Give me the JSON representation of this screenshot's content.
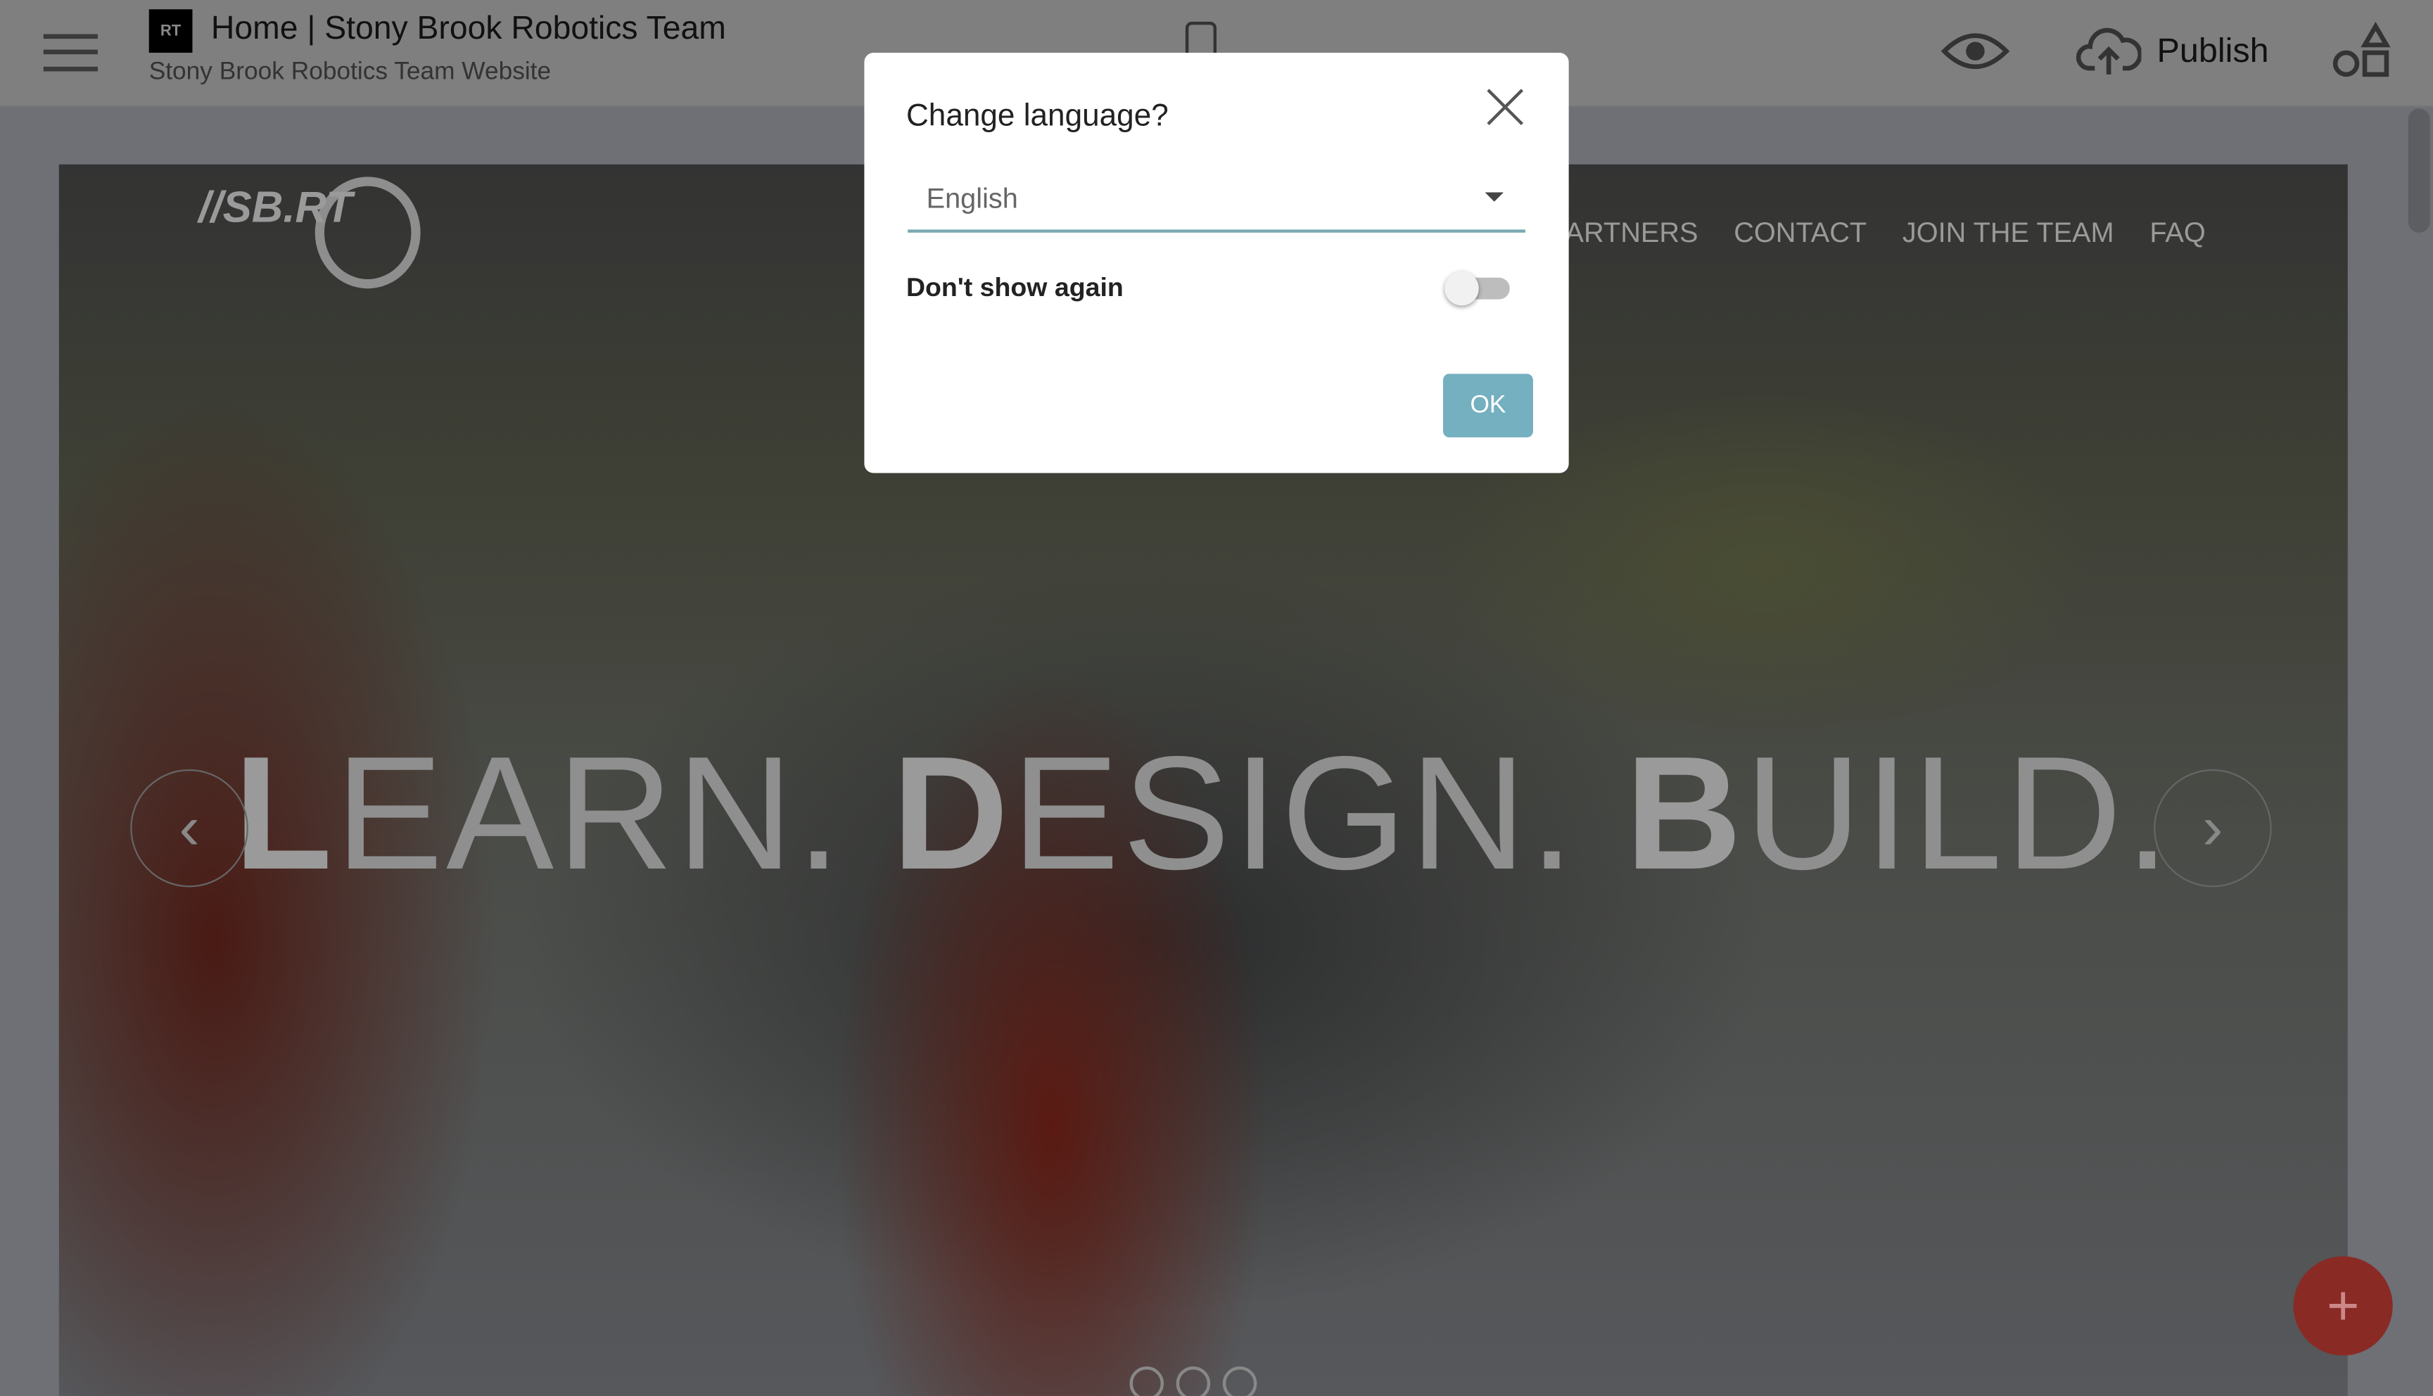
{
  "header": {
    "title": "Home | Stony Brook Robotics Team",
    "subtitle": "Stony Brook Robotics Team Website",
    "logo_text": "RT",
    "publish_label": "Publish"
  },
  "hero": {
    "logo_text": "//SB.RT",
    "nav": [
      "PARTNERS",
      "CONTACT",
      "JOIN THE TEAM",
      "FAQ"
    ],
    "headline": [
      {
        "first": "L",
        "rest": "EARN. "
      },
      {
        "first": "D",
        "rest": "ESIGN. "
      },
      {
        "first": "B",
        "rest": "UILD."
      }
    ],
    "prev_arrow": "‹",
    "next_arrow": "›",
    "fab": "+"
  },
  "modal": {
    "title": "Change language?",
    "language": "English",
    "dont_show_label": "Don't show again",
    "dont_show_checked": false,
    "ok_label": "OK"
  },
  "colors": {
    "accent": "#74b0bf",
    "fab": "#c0392b"
  }
}
